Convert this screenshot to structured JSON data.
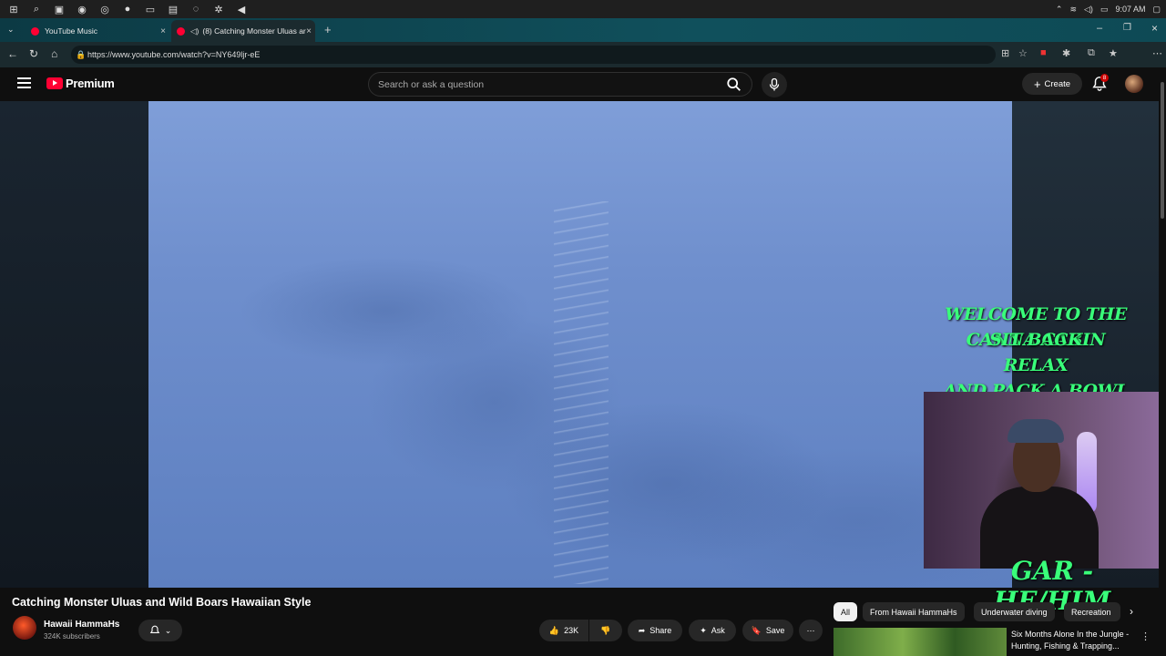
{
  "taskbar": {
    "time": "9:07 AM"
  },
  "tabs": [
    {
      "label": "YouTube Music"
    },
    {
      "label": "(8) Catching Monster Uluas ar"
    }
  ],
  "browser": {
    "url": "https://www.youtube.com/watch?v=NY649ljr-eE"
  },
  "header": {
    "logo": "Premium",
    "search_placeholder": "Search or ask a question",
    "create_label": "Create",
    "notification_count": "8"
  },
  "overlay": {
    "lines": [
      "WELCOME TO THE CANNA CABIN",
      "SIT BACK",
      "RELAX",
      "AND PACK A BOWL"
    ],
    "pronouns": "GAR - HE/HIM"
  },
  "video": {
    "title": "Catching Monster Uluas and Wild Boars Hawaiian Style",
    "channel": "Hawaii HammaHs",
    "subscribers": "324K subscribers",
    "likes": "23K",
    "share_label": "Share",
    "ask_label": "Ask",
    "save_label": "Save"
  },
  "chips": [
    "All",
    "From Hawaii HammaHs",
    "Underwater diving",
    "Recreation"
  ],
  "recommendation": {
    "title": "Six Months Alone In the Jungle - Hunting, Fishing & Trapping..."
  }
}
